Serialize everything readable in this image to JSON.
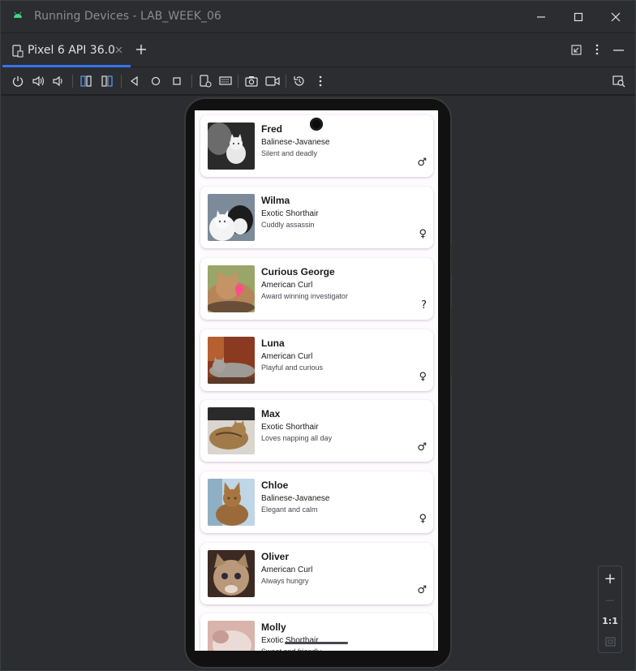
{
  "window": {
    "title": "Running Devices - LAB_WEEK_06",
    "minimize_icon": "minimize-icon",
    "maximize_icon": "maximize-icon",
    "close_icon": "close-icon"
  },
  "tabs": [
    {
      "label": "Pixel 6 API 36.0",
      "icon": "device-icon",
      "close_icon": "close-icon"
    }
  ],
  "tabbar_actions": [
    "new-tab-icon",
    "restore-icon",
    "more-icon",
    "hide-icon"
  ],
  "toolbar": {
    "items": [
      "power-icon",
      "volume-up-icon",
      "volume-down-icon",
      "rotate-left-icon",
      "rotate-right-icon",
      "back-icon",
      "home-icon",
      "overview-icon",
      "device-frame-icon",
      "keyboard-icon",
      "screenshot-icon",
      "record-icon",
      "reset-icon",
      "more-icon"
    ],
    "right_item": "device-inspector-icon"
  },
  "zoom": {
    "zoom_in": "+",
    "zoom_out": "—",
    "actual_size": "1:1",
    "fit_icon": "fit-screen-icon"
  },
  "colors": {
    "accent": "#3574f0",
    "screen_bg": "#fefbff",
    "card_bg": "#ffffff"
  },
  "cats": [
    {
      "name": "Fred",
      "breed": "Balinese-Javanese",
      "description": "Silent and deadly",
      "gender": "♂"
    },
    {
      "name": "Wilma",
      "breed": "Exotic Shorthair",
      "description": "Cuddly assassin",
      "gender": "♀"
    },
    {
      "name": "Curious George",
      "breed": "American Curl",
      "description": "Award winning investigator",
      "gender": "?"
    },
    {
      "name": "Luna",
      "breed": "American Curl",
      "description": "Playful and curious",
      "gender": "♀"
    },
    {
      "name": "Max",
      "breed": "Exotic Shorthair",
      "description": "Loves napping all day",
      "gender": "♂"
    },
    {
      "name": "Chloe",
      "breed": "Balinese-Javanese",
      "description": "Elegant and calm",
      "gender": "♀"
    },
    {
      "name": "Oliver",
      "breed": "American Curl",
      "description": "Always hungry",
      "gender": "♂"
    },
    {
      "name": "Molly",
      "breed": "Exotic Shorthair",
      "description": "Sweet and friendly",
      "gender": ""
    }
  ]
}
